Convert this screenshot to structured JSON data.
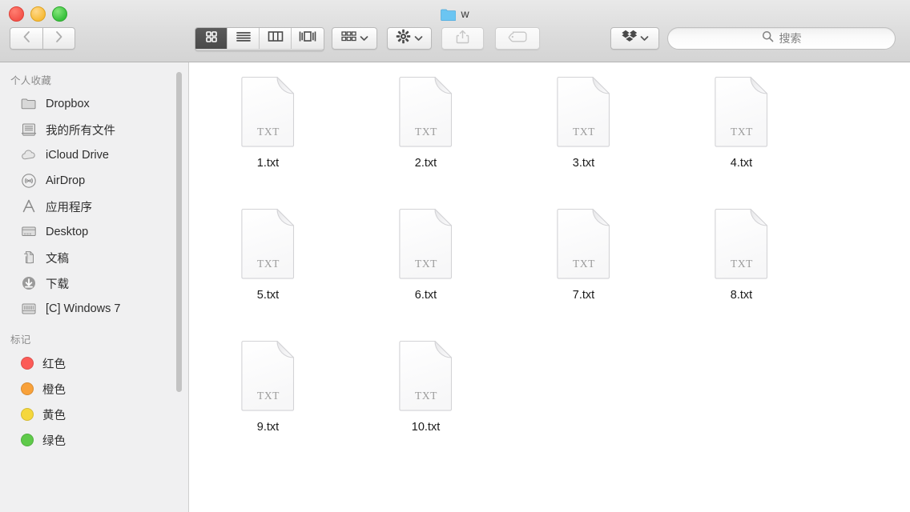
{
  "window": {
    "title": "w",
    "folder_icon": "folder-icon",
    "traffic_lights": [
      {
        "name": "close",
        "color": "#f4544b"
      },
      {
        "name": "minimize",
        "color": "#f7bc3a"
      },
      {
        "name": "zoom",
        "color": "#38c13c"
      }
    ]
  },
  "toolbar": {
    "back_label": "",
    "forward_label": "",
    "nav_back_icon": "chevron-left-icon",
    "nav_forward_icon": "chevron-right-icon",
    "view_modes": [
      {
        "name": "icon-view",
        "icon": "grid-icon",
        "active": true
      },
      {
        "name": "list-view",
        "icon": "list-icon",
        "active": false
      },
      {
        "name": "column-view",
        "icon": "columns-icon",
        "active": false
      },
      {
        "name": "gallery-view",
        "icon": "coverflow-icon",
        "active": false
      }
    ],
    "arrange": {
      "icon": "arrange-grid-icon",
      "chevron": "chevron-down-icon"
    },
    "action": {
      "icon": "gear-icon",
      "chevron": "chevron-down-icon"
    },
    "share": {
      "icon": "share-icon",
      "enabled": false
    },
    "tags": {
      "icon": "tag-icon",
      "enabled": false
    },
    "dropbox": {
      "icon": "dropbox-icon",
      "chevron": "chevron-down-icon"
    }
  },
  "search": {
    "icon": "search-icon",
    "placeholder": "搜索",
    "value": ""
  },
  "sidebar": {
    "sections": [
      {
        "header": "个人收藏",
        "items": [
          {
            "label": "Dropbox",
            "icon": "folder-icon"
          },
          {
            "label": "我的所有文件",
            "icon": "all-files-icon"
          },
          {
            "label": "iCloud Drive",
            "icon": "cloud-icon"
          },
          {
            "label": "AirDrop",
            "icon": "airdrop-icon"
          },
          {
            "label": "应用程序",
            "icon": "applications-icon"
          },
          {
            "label": "Desktop",
            "icon": "desktop-icon"
          },
          {
            "label": "文稿",
            "icon": "documents-icon"
          },
          {
            "label": "下载",
            "icon": "downloads-icon"
          },
          {
            "label": "[C] Windows 7",
            "icon": "disk-icon"
          }
        ]
      },
      {
        "header": "标记",
        "items": [
          {
            "label": "红色",
            "icon": "tag-dot",
            "color": "#fc5b57"
          },
          {
            "label": "橙色",
            "icon": "tag-dot",
            "color": "#f8a13a"
          },
          {
            "label": "黄色",
            "icon": "tag-dot",
            "color": "#f5d73c"
          },
          {
            "label": "绿色",
            "icon": "tag-dot",
            "color": "#5fca4a"
          }
        ]
      }
    ]
  },
  "files": [
    {
      "name": "1.txt",
      "kind": "TXT"
    },
    {
      "name": "2.txt",
      "kind": "TXT"
    },
    {
      "name": "3.txt",
      "kind": "TXT"
    },
    {
      "name": "4.txt",
      "kind": "TXT"
    },
    {
      "name": "5.txt",
      "kind": "TXT"
    },
    {
      "name": "6.txt",
      "kind": "TXT"
    },
    {
      "name": "7.txt",
      "kind": "TXT"
    },
    {
      "name": "8.txt",
      "kind": "TXT"
    },
    {
      "name": "9.txt",
      "kind": "TXT"
    },
    {
      "name": "10.txt",
      "kind": "TXT"
    }
  ],
  "colors": {
    "titlebar": "#dcdcdc",
    "sidebar_bg": "#f0f0f1",
    "content_bg": "#ffffff",
    "active_view_bg": "#4f4f4f"
  }
}
